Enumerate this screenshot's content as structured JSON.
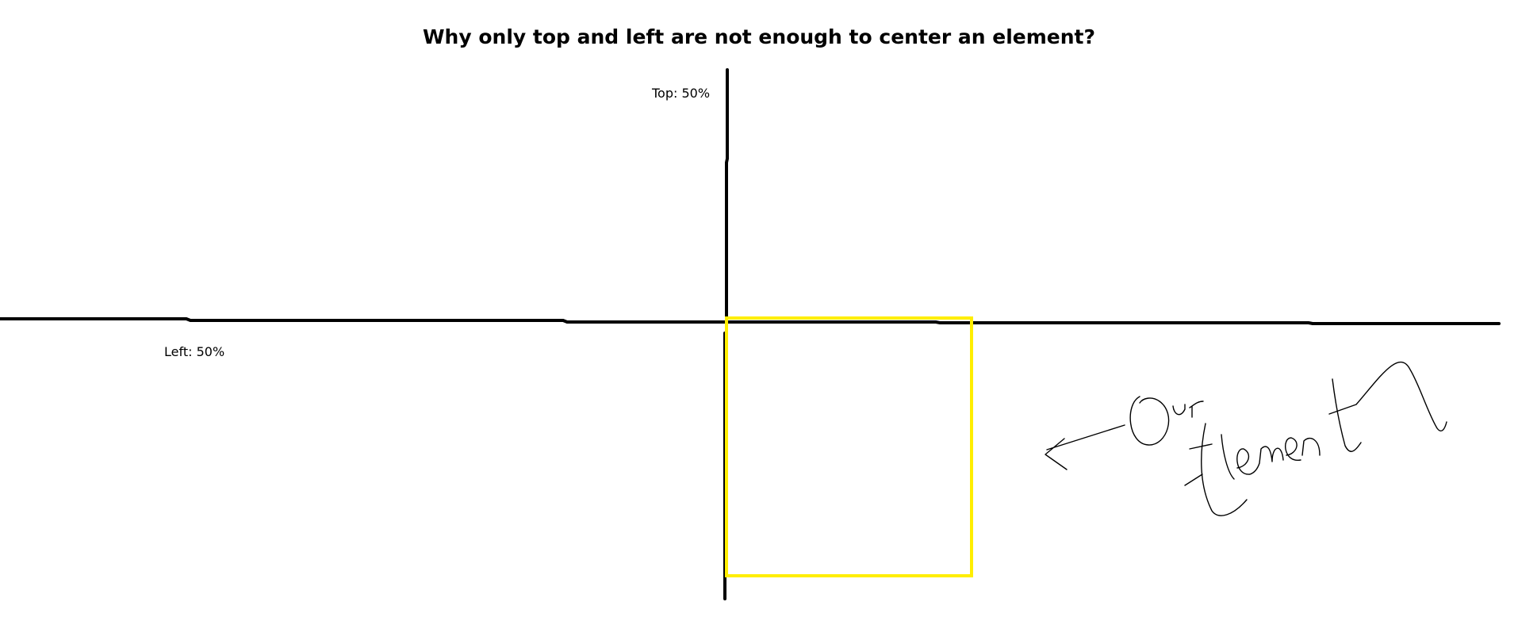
{
  "title": "Why only top and left are not enough to center an element?",
  "labels": {
    "top": "Top: 50%",
    "left": "Left: 50%",
    "element_annotation": "Our Element"
  },
  "colors": {
    "background": "#ffffff",
    "axis_line": "#000000",
    "element_outline": "#ffee00",
    "handwriting": "#000000"
  }
}
